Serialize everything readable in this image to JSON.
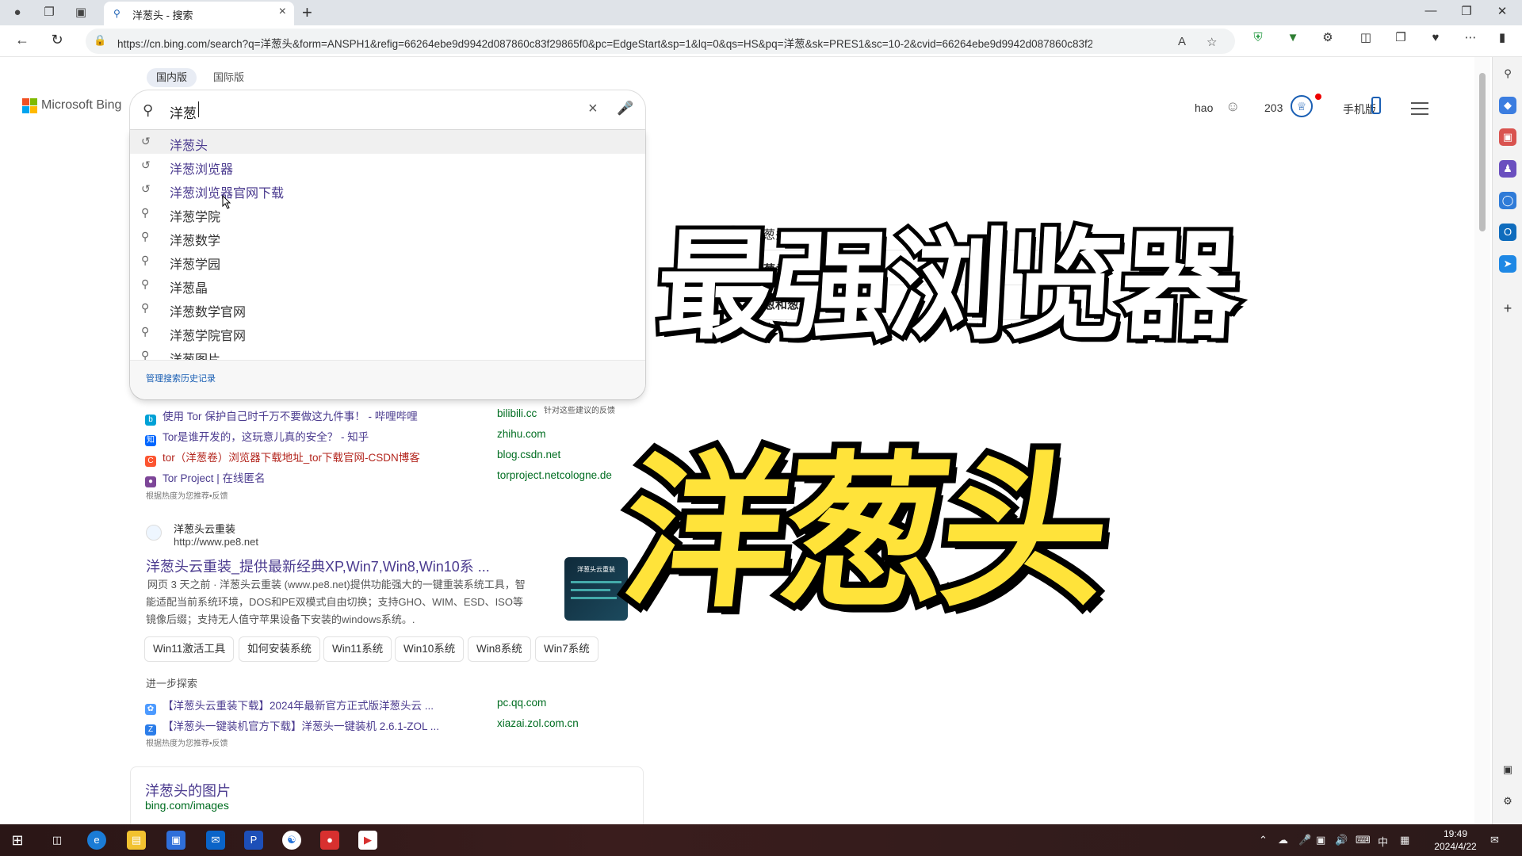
{
  "browser": {
    "tab_title": "洋葱头 - 搜索",
    "url": "https://cn.bing.com/search?q=洋葱头&form=ANSPH1&refig=66264ebe9d9942d087860c83f29865f0&pc=EdgeStart&sp=1&lq=0&qs=HS&pq=洋葱&sk=PRES1&sc=10-2&cvid=66264ebe9d9942d087860c83f2986..."
  },
  "bing": {
    "scopes": [
      "国内版",
      "国际版"
    ],
    "logo": "Microsoft Bing",
    "query": "洋葱",
    "user": "hao",
    "points": "203",
    "mobile": "手机版"
  },
  "suggestions": [
    {
      "text": "洋葱头",
      "type": "history"
    },
    {
      "text": "洋葱浏览器",
      "type": "history"
    },
    {
      "text": "洋葱浏览器官网下载",
      "type": "history"
    },
    {
      "text": "洋葱学院",
      "type": "search"
    },
    {
      "text": "洋葱数学",
      "type": "search"
    },
    {
      "text": "洋葱学园",
      "type": "search"
    },
    {
      "text": "洋葱晶",
      "type": "search"
    },
    {
      "text": "洋葱数学官网",
      "type": "search"
    },
    {
      "text": "洋葱学院官网",
      "type": "search"
    },
    {
      "text": "洋葱图片",
      "type": "search"
    }
  ],
  "suggest_footer": "管理搜索历史记录",
  "feedback_hint": "针对这些建议的反馈",
  "top_results": [
    {
      "title": "使用 Tor 保护自己时千万不要做这九件事！ - 哔哩哔哩",
      "domain": "bilibili.cc"
    },
    {
      "title": "Tor是谁开发的，这玩意儿真的安全？ - 知乎",
      "domain": "zhihu.com"
    },
    {
      "title": "tor（洋葱卷）浏览器下载地址_tor下载官网-CSDN博客",
      "domain": "blog.csdn.net"
    },
    {
      "title": "Tor Project | 在线匿名",
      "domain": "torproject.netcologne.de"
    }
  ],
  "hint_text": "根据热度为您推荐•反馈",
  "main_result": {
    "site": "洋葱头云重装",
    "url": "http://www.pe8.net",
    "title": "洋葱头云重装_提供最新经典XP,Win7,Win8,Win10系 ...",
    "snippet1": "网页  3 天之前 · 洋葱头云重装 (www.pe8.net)提供功能强大的一键重装系统工具，智",
    "snippet2": "能适配当前系统环境，DOS和PE双模式自由切换；支持GHO、WIM、ESD、ISO等",
    "snippet3": "镜像后缀；支持无人值守苹果设备下安装的windows系统。.",
    "thumb_text": "洋葱头云重装",
    "chips": [
      "Win11激活工具",
      "如何安装系统",
      "Win11系统",
      "Win10系统",
      "Win8系统",
      "Win7系统"
    ]
  },
  "explore": {
    "heading": "进一步探索",
    "items": [
      {
        "title": "【洋葱头云重装下载】2024年最新官方正式版洋葱头云 ...",
        "domain": "pc.qq.com"
      },
      {
        "title": "【洋葱头一键装机官方下载】洋葱头一键装机 2.6.1-ZOL ...",
        "domain": "xiazai.zol.com.cn"
      }
    ]
  },
  "images_card": {
    "title": "洋葱头的图片",
    "domain": "bing.com/images"
  },
  "related": [
    "红葱头和黄葱头的区别",
    "洋葱头是什么意思",
    "洋葱和葱头的区别"
  ],
  "overlay": {
    "line1": "最强浏览器",
    "line2": "洋葱头"
  },
  "taskbar": {
    "time": "19:49",
    "date": "2024/4/22",
    "ime": "中"
  },
  "colors": {
    "link": "#4b3b8f",
    "domain": "#006d21",
    "accent": "#1a5fb4",
    "caption_yellow": "#ffe33a"
  }
}
